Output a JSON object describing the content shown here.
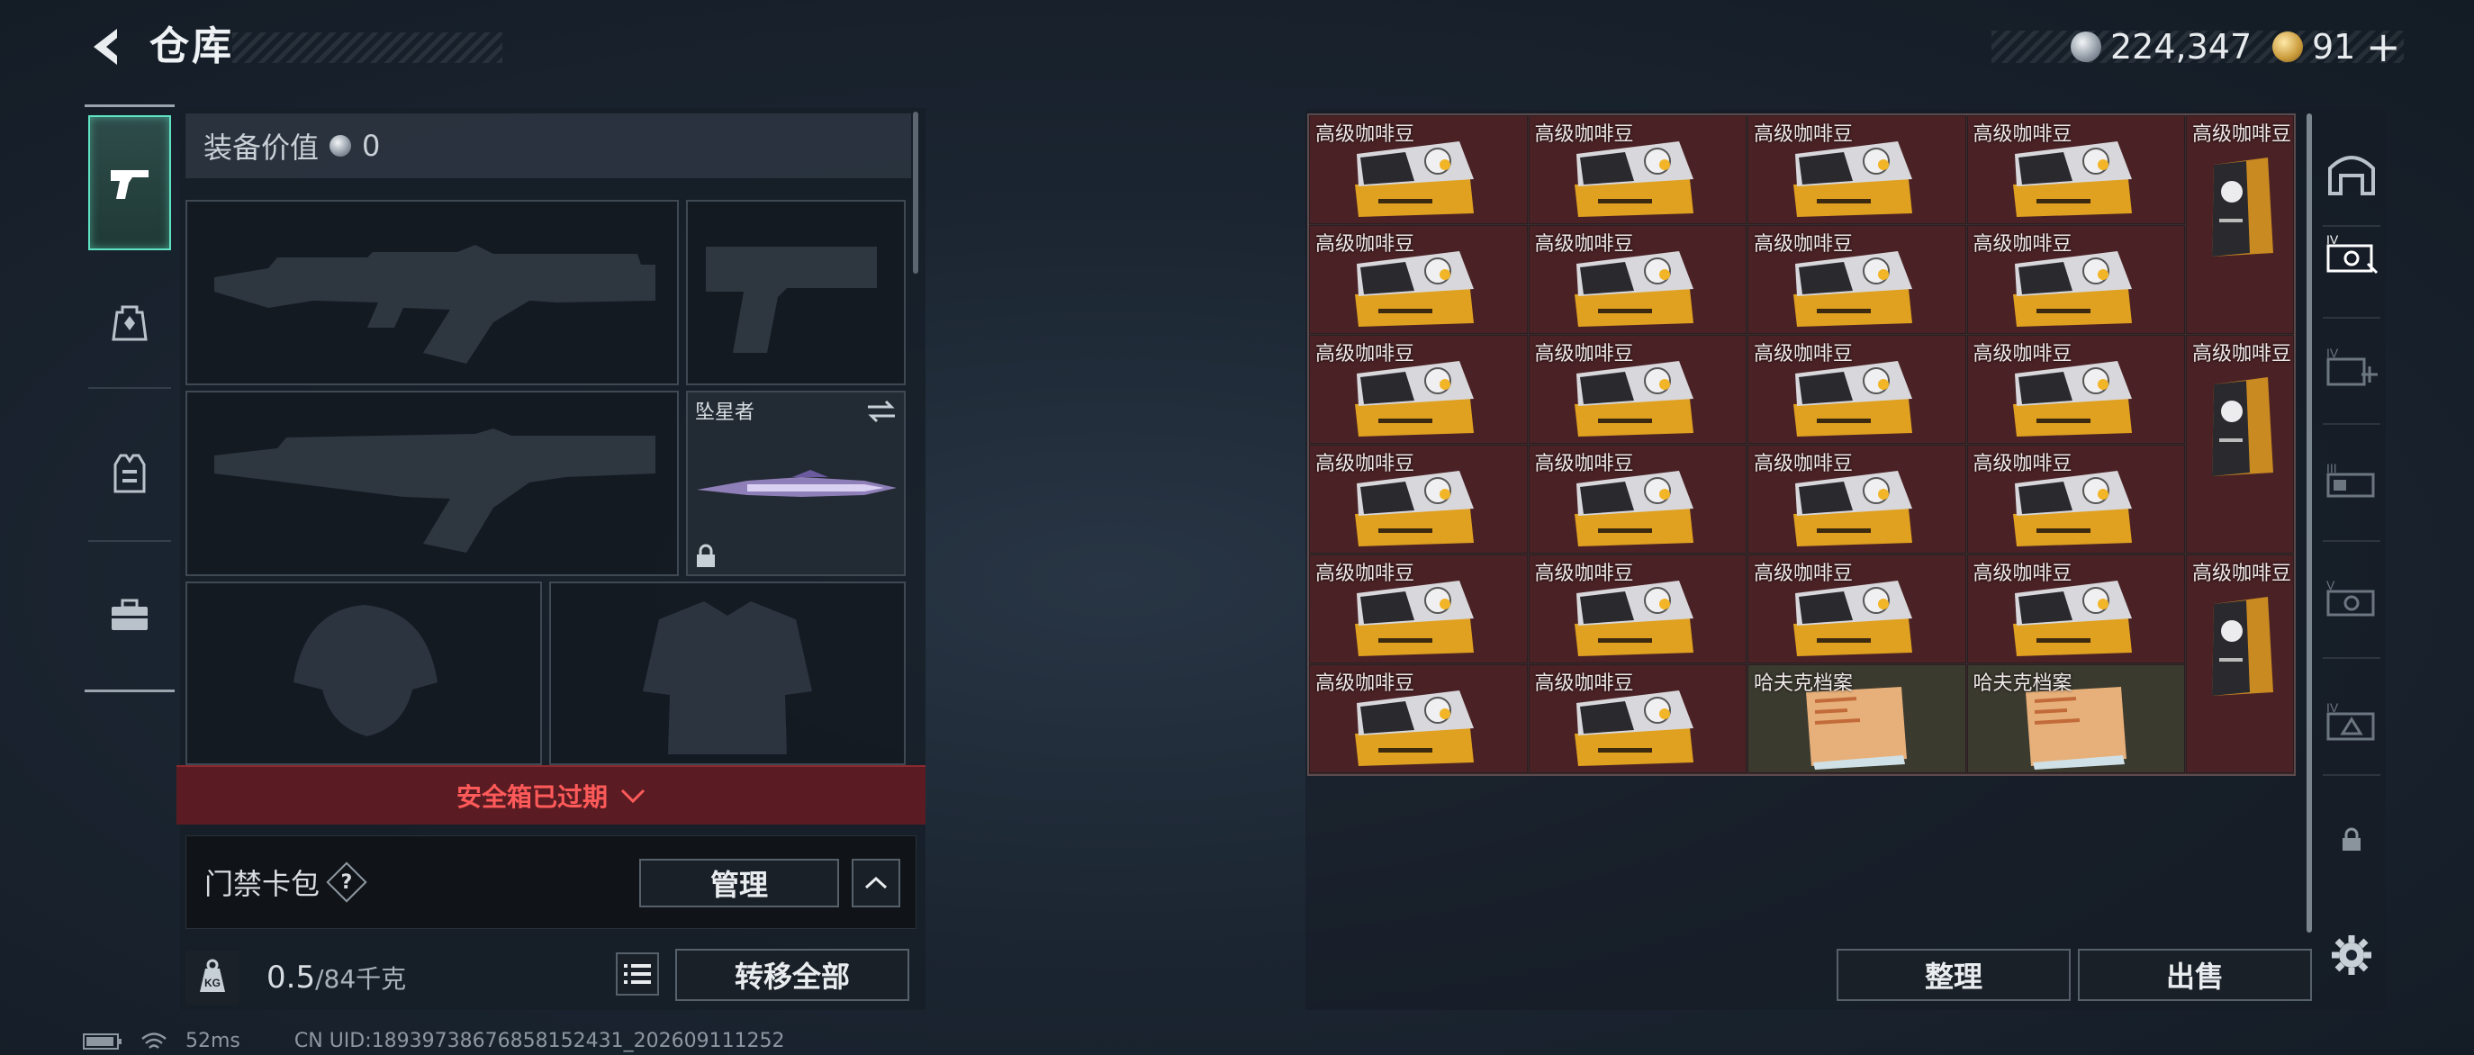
{
  "header": {
    "title": "仓库",
    "currency": {
      "silver_amount": "224,347",
      "gold_amount": "91",
      "plus_label": "+"
    }
  },
  "left_nav": {
    "items": [
      {
        "icon": "pistol-icon",
        "active": true
      },
      {
        "icon": "backpack-icon",
        "active": false
      },
      {
        "icon": "vest-icon",
        "active": false
      },
      {
        "icon": "toolbox-icon",
        "active": false
      }
    ]
  },
  "equipment": {
    "value_label": "装备价值",
    "value_amount": "0",
    "melee_slot_name": "坠星者",
    "safebox_status": "安全箱已过期",
    "keycard_label": "门禁卡包",
    "help_symbol": "?",
    "manage_button": "管理",
    "weight_unit_badge": "KG",
    "weight_current": "0.5",
    "weight_capacity": "/84千克",
    "transfer_all_button": "转移全部"
  },
  "storage": {
    "rows": [
      [
        "高级咖啡豆",
        "高级咖啡豆",
        "高级咖啡豆",
        "高级咖啡豆"
      ],
      [
        "高级咖啡豆",
        "高级咖啡豆",
        "高级咖啡豆",
        "高级咖啡豆"
      ],
      [
        "高级咖啡豆",
        "高级咖啡豆",
        "高级咖啡豆",
        "高级咖啡豆"
      ],
      [
        "高级咖啡豆",
        "高级咖啡豆",
        "高级咖啡豆",
        "高级咖啡豆"
      ],
      [
        "高级咖啡豆",
        "高级咖啡豆",
        "高级咖啡豆",
        "高级咖啡豆"
      ],
      [
        "高级咖啡豆",
        "高级咖啡豆",
        "哈夫克档案",
        "哈夫克档案"
      ]
    ],
    "tall_items": [
      "高级咖啡豆",
      "高级咖啡豆",
      "高级咖啡豆"
    ],
    "sort_button": "整理",
    "sell_button": "出售"
  },
  "categories": [
    {
      "icon": "all-items-icon",
      "active": false
    },
    {
      "icon": "warehouse-iv-icon",
      "active": true
    },
    {
      "icon": "warehouse-iv-plus-icon",
      "active": false
    },
    {
      "icon": "warehouse-iii-icon",
      "active": false
    },
    {
      "icon": "warehouse-v-icon",
      "active": false
    },
    {
      "icon": "warehouse-iv-alt-icon",
      "active": false
    },
    {
      "icon": "lock-icon",
      "active": false
    }
  ],
  "footer": {
    "ping": "52ms",
    "uid": "CN UID:18939738676858152431_202609111252"
  },
  "colors": {
    "accent_teal": "#5fe3c3",
    "warning_red": "#ff5a5a",
    "item_cell_red": "#4a2225"
  }
}
